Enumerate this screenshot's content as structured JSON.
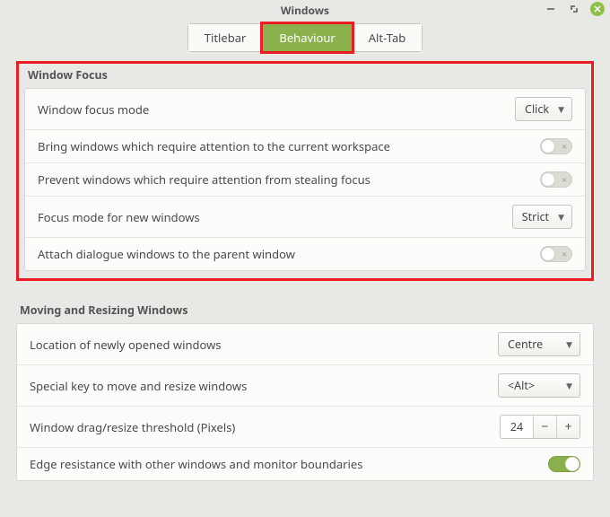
{
  "window": {
    "title": "Windows"
  },
  "tabs": {
    "titlebar": "Titlebar",
    "behaviour": "Behaviour",
    "alttab": "Alt-Tab",
    "active": "behaviour"
  },
  "focus": {
    "section_title": "Window Focus",
    "mode_label": "Window focus mode",
    "mode_value": "Click",
    "bring_label": "Bring windows which require attention to the current workspace",
    "bring_on": false,
    "prevent_label": "Prevent windows which require attention from stealing focus",
    "prevent_on": false,
    "newwin_label": "Focus mode for new windows",
    "newwin_value": "Strict",
    "attach_label": "Attach dialogue windows to the parent window",
    "attach_on": false
  },
  "move": {
    "section_title": "Moving and Resizing Windows",
    "location_label": "Location of newly opened windows",
    "location_value": "Centre",
    "special_label": "Special key to move and resize windows",
    "special_value": "<Alt>",
    "threshold_label": "Window drag/resize threshold (Pixels)",
    "threshold_value": "24",
    "edge_label": "Edge resistance with other windows and monitor boundaries",
    "edge_on": true
  }
}
